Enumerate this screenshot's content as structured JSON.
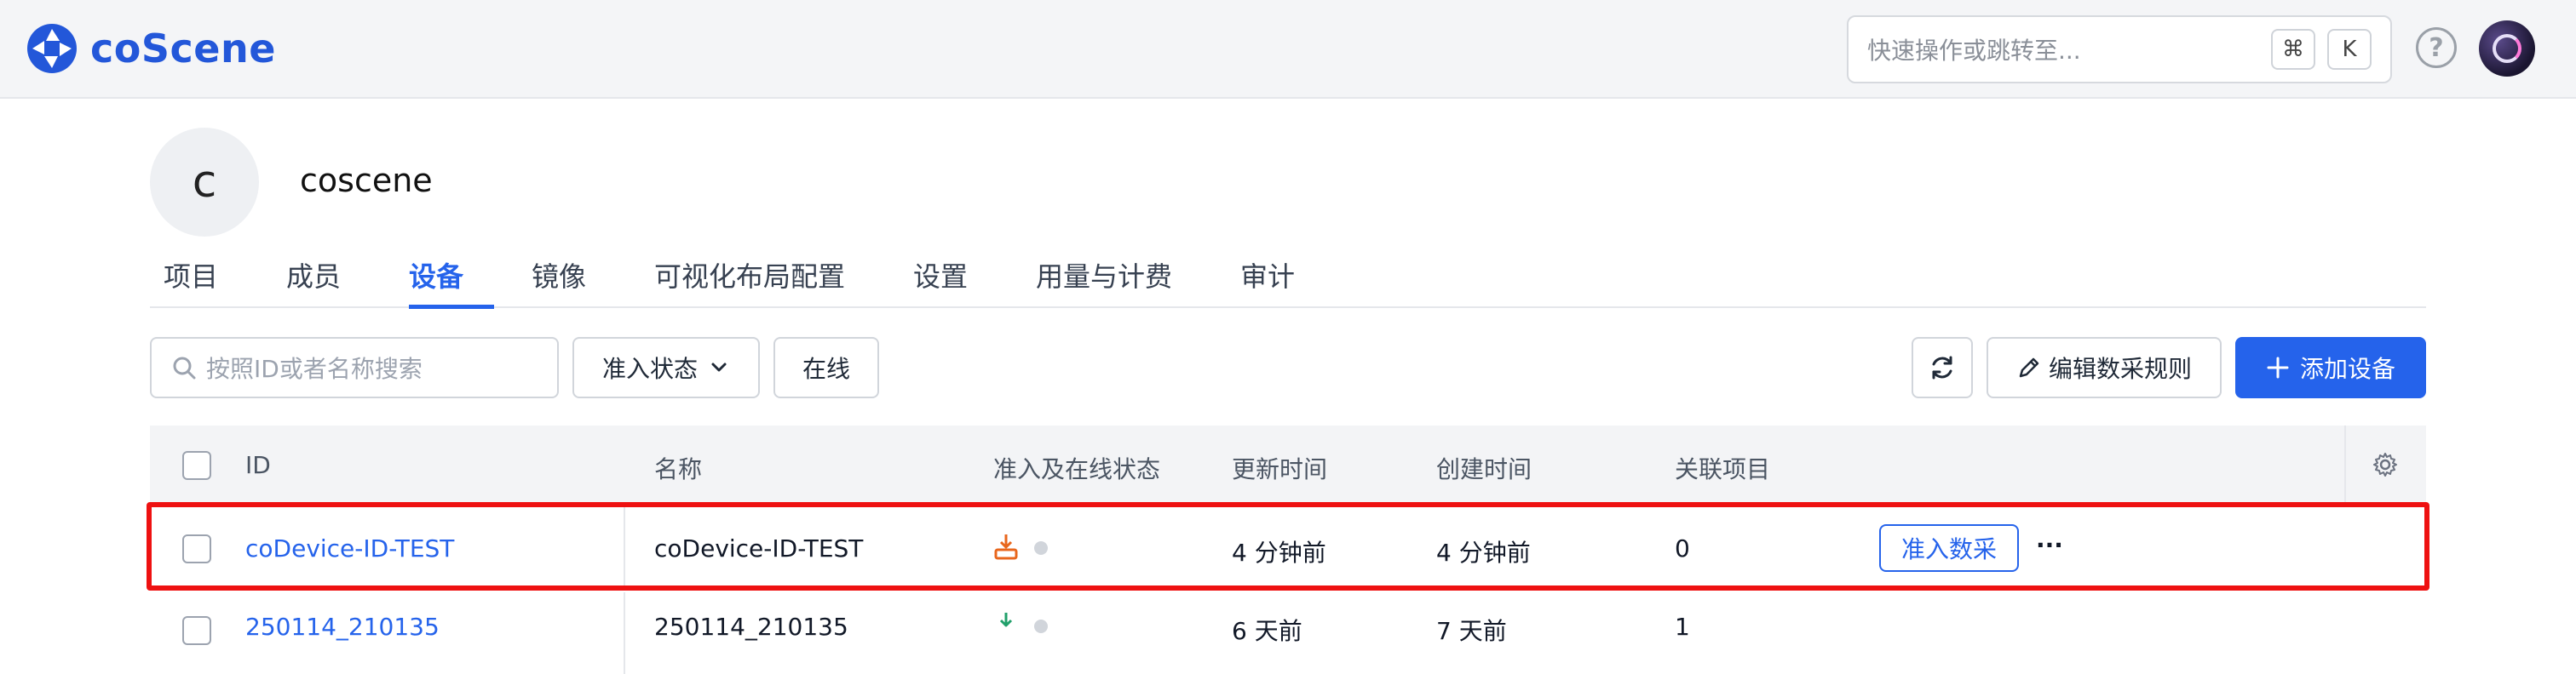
{
  "brand": {
    "name": "coScene",
    "color": "#2357d9"
  },
  "topbar": {
    "search_placeholder": "快速操作或跳转至...",
    "shortcut_key1": "⌘",
    "shortcut_key2": "K",
    "help_icon": "?"
  },
  "org": {
    "initial": "c",
    "name": "coscene"
  },
  "tabs": [
    {
      "label": "项目"
    },
    {
      "label": "成员"
    },
    {
      "label": "设备",
      "active": true
    },
    {
      "label": "镜像"
    },
    {
      "label": "可视化布局配置"
    },
    {
      "label": "设置"
    },
    {
      "label": "用量与计费"
    },
    {
      "label": "审计"
    }
  ],
  "toolbar": {
    "search_placeholder": "按照ID或者名称搜索",
    "admit_filter": "准入状态",
    "online_filter": "在线",
    "edit_rules": "编辑数采规则",
    "add_device": "添加设备"
  },
  "table": {
    "headers": {
      "id": "ID",
      "name": "名称",
      "status": "准入及在线状态",
      "updated": "更新时间",
      "created": "创建时间",
      "projects": "关联项目"
    },
    "rows": [
      {
        "id": "coDevice-ID-TEST",
        "name": "coDevice-ID-TEST",
        "updated": "4 分钟前",
        "created": "4 分钟前",
        "projects": "0",
        "action": "准入数采",
        "more": "···"
      },
      {
        "id": "250114_210135",
        "name": "250114_210135",
        "updated": "6 天前",
        "created": "7 天前",
        "projects": "1"
      }
    ]
  },
  "colors": {
    "accent": "#2563eb",
    "highlight": "#ee1111",
    "pending": "#e8661c",
    "admitted": "#22a06b"
  }
}
